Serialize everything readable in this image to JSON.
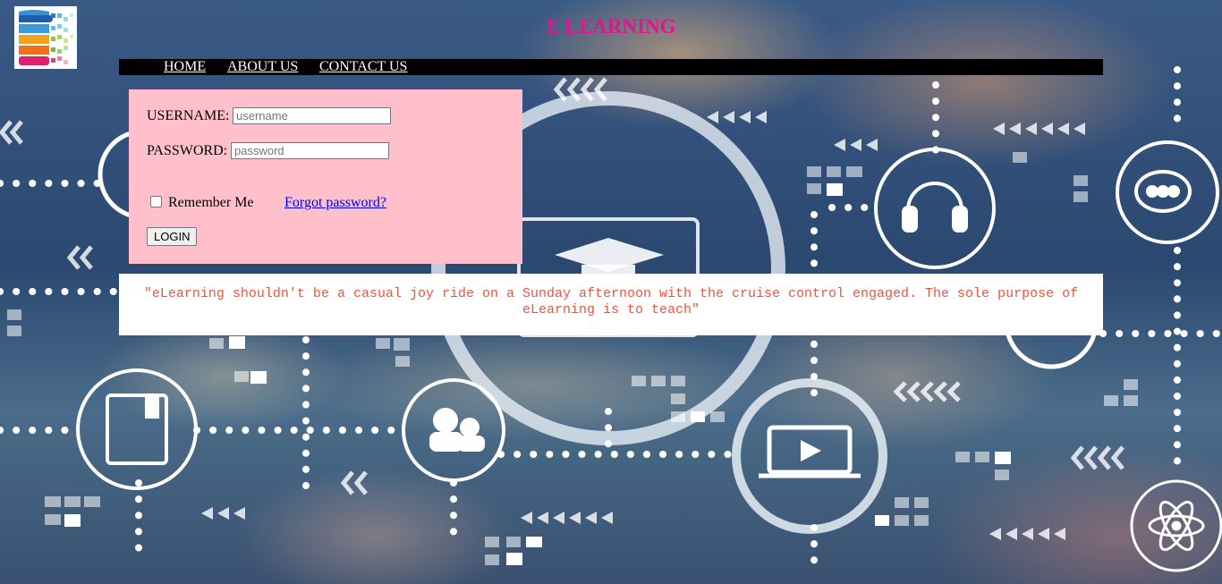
{
  "header": {
    "title": "E LEARNING"
  },
  "nav": {
    "home": "HOME",
    "about": "ABOUT US",
    "contact": "CONTACT US"
  },
  "login": {
    "username_label": "USERNAME:",
    "username_placeholder": "username",
    "password_label": "PASSWORD:",
    "password_placeholder": "password",
    "remember_label": "Remember Me",
    "forgot_label": "Forgot password?",
    "login_button": "LOGIN"
  },
  "quote": {
    "text": "\"eLearning shouldn't be a casual joy ride on a Sunday afternoon with the cruise control engaged. The sole purpose of eLearning is to teach\""
  },
  "colors": {
    "title": "#e0158f",
    "navbar": "#000000",
    "login_bg": "#ffc0cb",
    "quote_text": "#f0533d"
  },
  "icons": [
    "logo-icon",
    "graduation-cap-icon",
    "headphones-icon",
    "chat-bubble-icon",
    "book-icon",
    "users-icon",
    "video-play-icon",
    "atom-icon"
  ]
}
